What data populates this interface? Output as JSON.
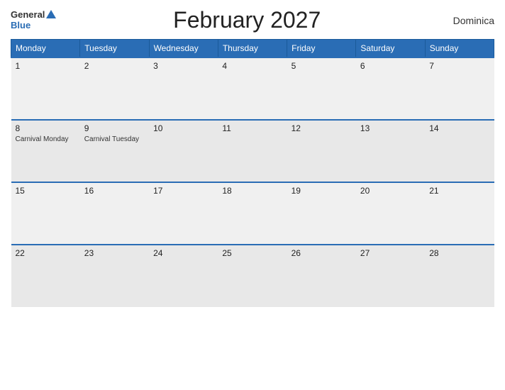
{
  "header": {
    "logo_general": "General",
    "logo_blue": "Blue",
    "title": "February 2027",
    "country": "Dominica"
  },
  "weekdays": [
    "Monday",
    "Tuesday",
    "Wednesday",
    "Thursday",
    "Friday",
    "Saturday",
    "Sunday"
  ],
  "weeks": [
    [
      {
        "day": "1",
        "events": []
      },
      {
        "day": "2",
        "events": []
      },
      {
        "day": "3",
        "events": []
      },
      {
        "day": "4",
        "events": []
      },
      {
        "day": "5",
        "events": []
      },
      {
        "day": "6",
        "events": []
      },
      {
        "day": "7",
        "events": []
      }
    ],
    [
      {
        "day": "8",
        "events": [
          "Carnival Monday"
        ]
      },
      {
        "day": "9",
        "events": [
          "Carnival Tuesday"
        ]
      },
      {
        "day": "10",
        "events": []
      },
      {
        "day": "11",
        "events": []
      },
      {
        "day": "12",
        "events": []
      },
      {
        "day": "13",
        "events": []
      },
      {
        "day": "14",
        "events": []
      }
    ],
    [
      {
        "day": "15",
        "events": []
      },
      {
        "day": "16",
        "events": []
      },
      {
        "day": "17",
        "events": []
      },
      {
        "day": "18",
        "events": []
      },
      {
        "day": "19",
        "events": []
      },
      {
        "day": "20",
        "events": []
      },
      {
        "day": "21",
        "events": []
      }
    ],
    [
      {
        "day": "22",
        "events": []
      },
      {
        "day": "23",
        "events": []
      },
      {
        "day": "24",
        "events": []
      },
      {
        "day": "25",
        "events": []
      },
      {
        "day": "26",
        "events": []
      },
      {
        "day": "27",
        "events": []
      },
      {
        "day": "28",
        "events": []
      }
    ]
  ]
}
